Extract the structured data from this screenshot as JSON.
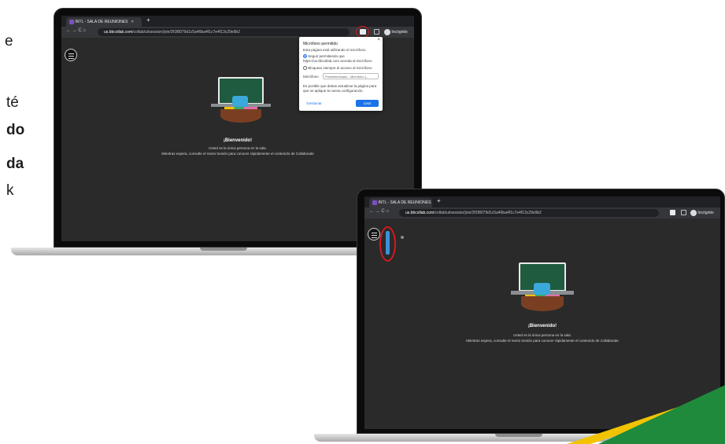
{
  "side_text": [
    {
      "text": "e",
      "bold": false
    },
    {
      "text": "té",
      "bold": false
    },
    {
      "text": "do",
      "bold": true
    },
    {
      "text": "da",
      "bold": true
    },
    {
      "text": "k",
      "bold": false
    }
  ],
  "colors": {
    "accent_red": "#d71920",
    "brand_green": "#1f8a3c",
    "brand_yellow": "#f2c300",
    "browser_dark": "#202124",
    "page_bg": "#2a2a2a",
    "blue_button": "#1a73e8"
  },
  "laptop1": {
    "tab_title": "INTL - SALA DE REUNIONES",
    "tab_close": "×",
    "new_tab": "+",
    "url_domain": "us.bbcollab.com",
    "url_path": "/collab/ui/session/join/3f1f8079d1c5a46ba4f1c7e4f13c29e9b2",
    "nav": "←  →  C  ⌂",
    "profile_label": "Incógnito",
    "welcome": "¡Bienvenido!",
    "msg_line1": "Usted es la única persona en la sala.",
    "msg_line2": "Mientras espera, consulte el menú Sesión para conocer rápidamente el contenido de Collaborate",
    "popup": {
      "close": "×",
      "title": "Micrófono permitido",
      "subtitle": "Esta página está utilizando el micrófono",
      "option1": "Seguir permitiendo que https://us.bbcollab.com acceda al micrófono",
      "option2": "Bloquear siempre el acceso al micrófono",
      "mic_label": "Micrófono",
      "mic_value": "Predeterminado - Micrófono (...",
      "note": "Es posible que debas actualizar la página para que se aplique la nueva configuración.",
      "manage": "Gestionar",
      "done": "Listo"
    }
  },
  "laptop2": {
    "tab_title": "INTL - SALA DE REUNIONES",
    "tab_close": "×",
    "new_tab": "+",
    "url_domain": "us.bbcollab.com",
    "url_path": "/collab/ui/session/join/3f1f8079d1c5a46ba4f1c7e4f13c29e9b2",
    "nav": "←  →  C  ⌂",
    "profile_label": "Incógnito",
    "welcome": "¡Bienvenido!",
    "msg_line1": "Usted es la única persona en la sala.",
    "msg_line2": "Mientras espera, consulte el menú Sesión para conocer rápidamente el contenido de Collaborate"
  }
}
